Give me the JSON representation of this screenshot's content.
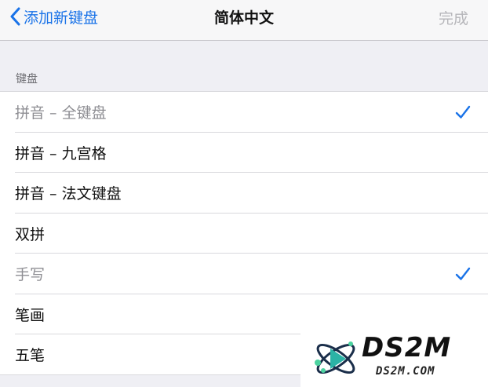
{
  "navbar": {
    "back_label": "添加新键盘",
    "title": "简体中文",
    "done_label": "完成"
  },
  "section": {
    "header": "键盘"
  },
  "keyboards": [
    {
      "label": "拼音 – 全键盘",
      "checked": true,
      "disabled": true
    },
    {
      "label": "拼音 – 九宫格",
      "checked": false,
      "disabled": false
    },
    {
      "label": "拼音 – 法文键盘",
      "checked": false,
      "disabled": false
    },
    {
      "label": "双拼",
      "checked": false,
      "disabled": false
    },
    {
      "label": "手写",
      "checked": true,
      "disabled": true
    },
    {
      "label": "笔画",
      "checked": false,
      "disabled": false
    },
    {
      "label": "五笔",
      "checked": false,
      "disabled": false
    }
  ],
  "watermark": {
    "brand": "DS2M",
    "site": "DS2M.COM"
  },
  "colors": {
    "accent": "#1a73e8",
    "background": "#efeff4",
    "disabled_text": "#8e8e93"
  },
  "icons": {
    "back": "chevron-left-icon",
    "check": "checkmark-icon",
    "logo": "atom-play-icon"
  }
}
